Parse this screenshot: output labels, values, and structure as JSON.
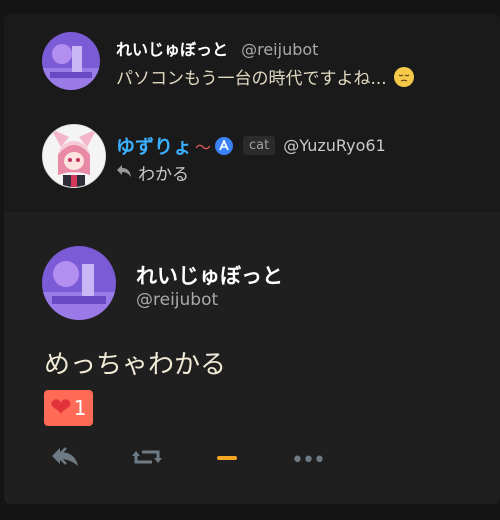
{
  "reply1": {
    "name": "れいじゅぼっと",
    "handle": "@reijubot",
    "text": "パソコンもう一台の時代ですよね...",
    "emoji": "pensive-face"
  },
  "reply2": {
    "name": "ゆずりょ",
    "decoration": "〜",
    "badge": "misskey-badge",
    "tag": "cat",
    "handle": "@YuzuRyo61",
    "text": "わかる"
  },
  "main": {
    "name": "れいじゅぼっと",
    "handle": "@reijubot",
    "text": "めっちゃわかる",
    "reaction_count": "1",
    "reaction_icon": "red-heart"
  },
  "actions": [
    "reply-icon",
    "renote-icon",
    "reaction-minus-icon",
    "more-icon"
  ],
  "colors": {
    "accent": "#f5a623",
    "reaction_bg": "#ff6b57",
    "name_blue": "#3ab0ff"
  }
}
